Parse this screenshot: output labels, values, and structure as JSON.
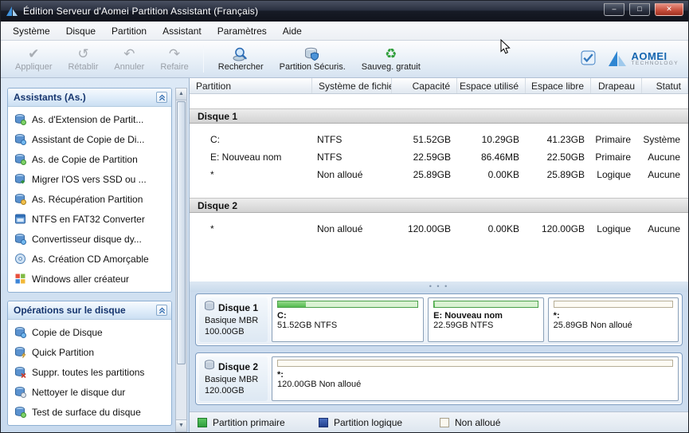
{
  "window": {
    "title": "Édition Serveur d'Aomei Partition Assistant (Français)",
    "controls": {
      "minimize": "–",
      "maximize": "□",
      "close": "✕"
    }
  },
  "menubar": {
    "items": [
      "Système",
      "Disque",
      "Partition",
      "Assistant",
      "Paramètres",
      "Aide"
    ]
  },
  "toolbar": {
    "disabled_buttons": [
      {
        "label": "Appliquer"
      },
      {
        "label": "Rétablir"
      },
      {
        "label": "Annuler"
      },
      {
        "label": "Refaire"
      }
    ],
    "action_buttons": [
      {
        "label": "Rechercher"
      },
      {
        "label": "Partition Sécuris."
      },
      {
        "label": "Sauveg. gratuit"
      }
    ],
    "brand": {
      "name": "AOMEI",
      "tagline": "TECHNOLOGY"
    }
  },
  "icons": {
    "apply": "✔",
    "discard": "↺",
    "undo": "↶",
    "redo": "↷",
    "backup": "♻",
    "scroll_up": "▲",
    "scroll_down": "▼",
    "splitter_dots": "• • •"
  },
  "sidebar": {
    "panels": [
      {
        "title": "Assistants (As.)",
        "items": [
          "As. d'Extension de Partit...",
          "Assistant de Copie de Di...",
          "As. de Copie de Partition",
          "Migrer l'OS vers SSD ou ...",
          "As. Récupération Partition",
          "NTFS en FAT32 Converter",
          "Convertisseur disque dy...",
          "As. Création CD Amorçable",
          "Windows aller créateur"
        ]
      },
      {
        "title": "Opérations sur le disque",
        "items": [
          "Copie de Disque",
          "Quick Partition",
          "Suppr. toutes les partitions",
          "Nettoyer le disque dur",
          "Test de surface du disque"
        ]
      }
    ]
  },
  "table": {
    "columns": [
      "Partition",
      "Système de fichier",
      "Capacité",
      "Espace utilisé",
      "Espace libre",
      "Drapeau",
      "Statut"
    ],
    "groups": [
      {
        "name": "Disque 1",
        "rows": [
          [
            "C:",
            "NTFS",
            "51.52GB",
            "10.29GB",
            "41.23GB",
            "Primaire",
            "Système"
          ],
          [
            "E: Nouveau nom",
            "NTFS",
            "22.59GB",
            "86.46MB",
            "22.50GB",
            "Primaire",
            "Aucune"
          ],
          [
            "*",
            "Non alloué",
            "25.89GB",
            "0.00KB",
            "25.89GB",
            "Logique",
            "Aucune"
          ]
        ]
      },
      {
        "name": "Disque 2",
        "rows": [
          [
            "*",
            "Non alloué",
            "120.00GB",
            "0.00KB",
            "120.00GB",
            "Logique",
            "Aucune"
          ]
        ]
      }
    ]
  },
  "disk_map": {
    "disks": [
      {
        "name": "Disque 1",
        "type": "Basique MBR",
        "size": "100.00GB",
        "partitions": [
          {
            "label": "C:",
            "detail": "51.52GB NTFS",
            "kind": "primary",
            "size_gb": 51.52,
            "used_percent": 20
          },
          {
            "label": "E: Nouveau nom",
            "detail": "22.59GB NTFS",
            "kind": "primary",
            "size_gb": 22.59,
            "used_percent": 1
          },
          {
            "label": "*:",
            "detail": "25.89GB Non alloué",
            "kind": "unallocated",
            "size_gb": 25.89,
            "used_percent": 0
          }
        ]
      },
      {
        "name": "Disque 2",
        "type": "Basique MBR",
        "size": "120.00GB",
        "partitions": [
          {
            "label": "*:",
            "detail": "120.00GB Non alloué",
            "kind": "unallocated",
            "size_gb": 120.0,
            "used_percent": 0
          }
        ]
      }
    ]
  },
  "legend": {
    "items": [
      {
        "label": "Partition primaire",
        "color": "#3cb44a"
      },
      {
        "label": "Partition logique",
        "color": "#2b50a8"
      },
      {
        "label": "Non alloué",
        "color": "#fbf8ef"
      }
    ]
  }
}
